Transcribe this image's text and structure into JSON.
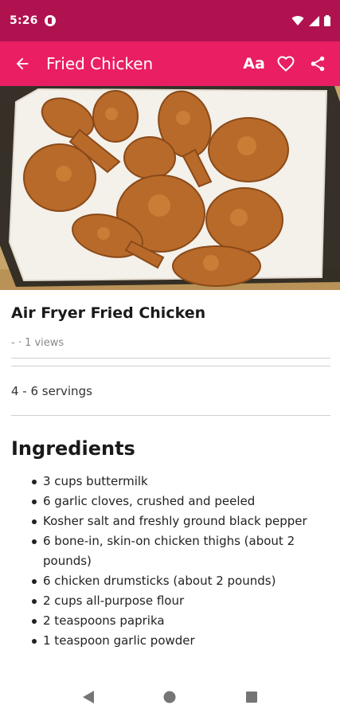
{
  "status_bar": {
    "time": "5:26"
  },
  "app_bar": {
    "title": "Fried Chicken",
    "font_button": "Aa"
  },
  "recipe": {
    "title": "Air Fryer Fried Chicken",
    "views": "- · 1 views",
    "servings": "4 - 6 servings",
    "ingredients_heading": "Ingredients",
    "ingredients": [
      "3 cups buttermilk",
      "6 garlic cloves, crushed and peeled",
      "Kosher salt and freshly ground black pepper",
      "6 bone-in, skin-on chicken thighs (about 2 pounds)",
      "6 chicken drumsticks (about 2 pounds)",
      "2 cups all-purpose flour",
      "2 teaspoons paprika",
      "1 teaspoon garlic powder"
    ]
  },
  "colors": {
    "status_bar": "#b0124f",
    "app_bar": "#e91e63"
  },
  "icons": {
    "app_bar": [
      "back-arrow-icon",
      "text-size-icon",
      "heart-icon",
      "share-icon"
    ],
    "status_bar": [
      "app-notification-icon",
      "wifi-icon",
      "signal-icon",
      "battery-icon"
    ],
    "nav_bar": [
      "back-triangle-icon",
      "home-circle-icon",
      "recents-square-icon"
    ]
  }
}
